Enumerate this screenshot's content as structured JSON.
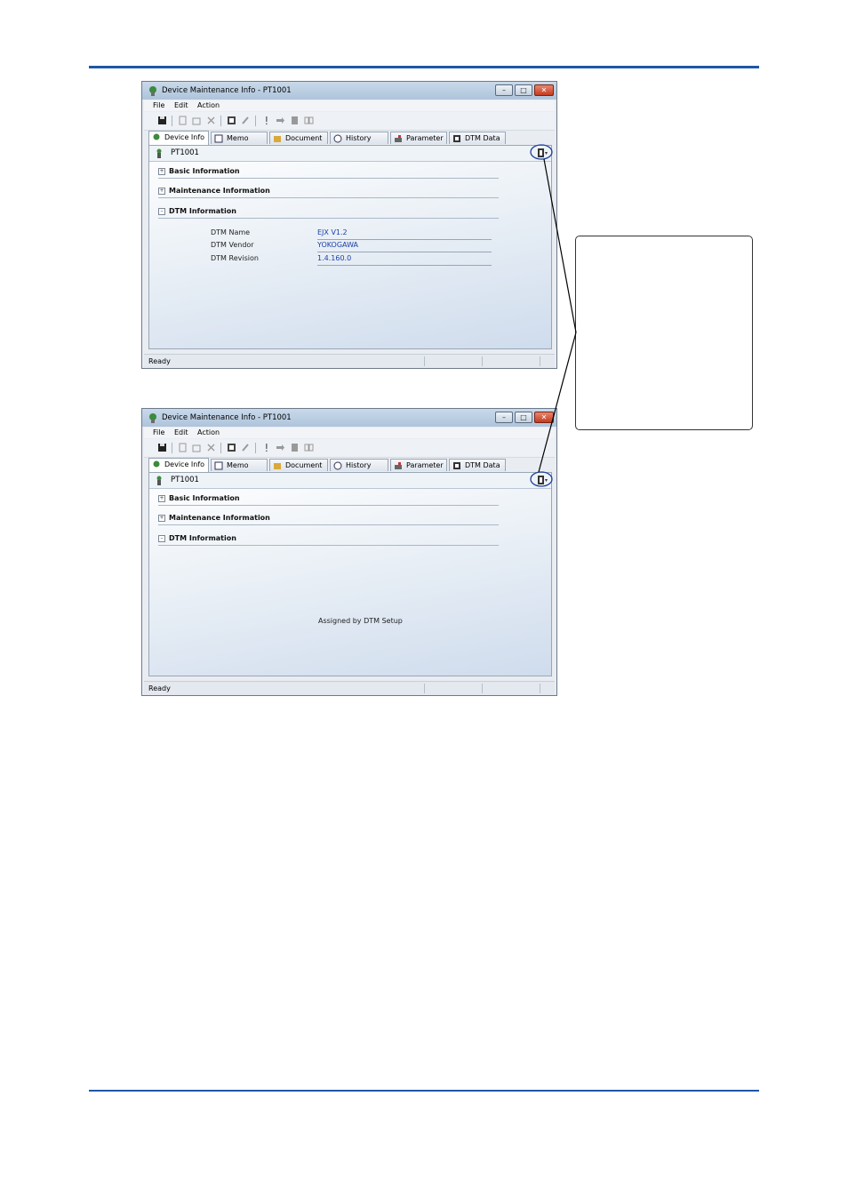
{
  "windows": [
    {
      "title": "Device Maintenance Info - PT1001",
      "menu": [
        "File",
        "Edit",
        "Action"
      ],
      "tabs": [
        "Device Info",
        "Memo",
        "Document",
        "History",
        "Parameter",
        "DTM Data"
      ],
      "active_tab": "Device Info",
      "device": "PT1001",
      "sections": [
        "Basic Information",
        "Maintenance Information",
        "DTM Information"
      ],
      "fields": [
        {
          "label": "DTM Name",
          "value": "EJX V1.2"
        },
        {
          "label": "DTM Vendor",
          "value": "YOKOGAWA"
        },
        {
          "label": "DTM Revision",
          "value": "1.4.160.0"
        }
      ],
      "status": "Ready"
    },
    {
      "title": "Device Maintenance Info - PT1001",
      "menu": [
        "File",
        "Edit",
        "Action"
      ],
      "tabs": [
        "Device Info",
        "Memo",
        "Document",
        "History",
        "Parameter",
        "DTM Data"
      ],
      "active_tab": "Device Info",
      "device": "PT1001",
      "sections": [
        "Basic Information",
        "Maintenance Information",
        "DTM Information"
      ],
      "assigned_text": "Assigned by DTM Setup",
      "status": "Ready"
    }
  ],
  "colors": {
    "rule": "#1f57a6",
    "value_text": "#1a3fa8",
    "highlight_ring": "#1f3f9a"
  }
}
